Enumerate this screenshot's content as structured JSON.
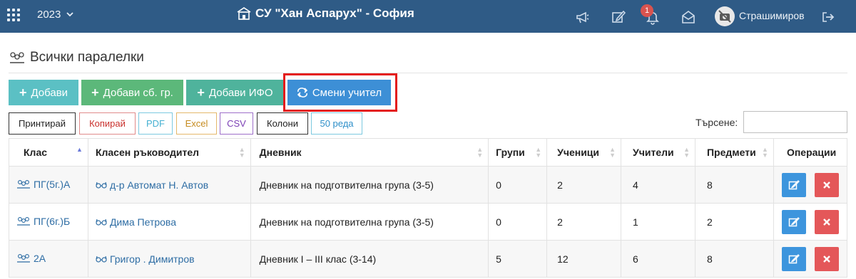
{
  "topbar": {
    "year": "2023",
    "school_name": "СУ \"Хан Аспарух\" - София",
    "notifications_count": "1",
    "username": "Страшимиров"
  },
  "page": {
    "title": "Всички паралелки"
  },
  "actions": {
    "add": "Добави",
    "add_group": "Добави сб. гр.",
    "add_ifo": "Добави ИФО",
    "change_teacher": "Смени учител"
  },
  "export": {
    "print": "Принтирай",
    "copy": "Копирай",
    "pdf": "PDF",
    "excel": "Excel",
    "csv": "CSV",
    "columns": "Колони",
    "page_size": "50 реда"
  },
  "search": {
    "label": "Търсене:",
    "value": ""
  },
  "table": {
    "headers": [
      "Клас",
      "Класен ръководител",
      "Дневник",
      "Групи",
      "Ученици",
      "Учители",
      "Предмети",
      "Операции"
    ],
    "rows": [
      {
        "klas": "ПГ(5г.)А",
        "teacher": "д-р Автомат Н. Автов",
        "diary": "Дневник на подготвителна група (3-5)",
        "groups": "0",
        "students": "2",
        "teachers": "4",
        "subjects": "8"
      },
      {
        "klas": "ПГ(6г.)Б",
        "teacher": "Дима Петрова",
        "diary": "Дневник на подготвителна група (3-5)",
        "groups": "0",
        "students": "2",
        "teachers": "1",
        "subjects": "2"
      },
      {
        "klas": "2А",
        "teacher": "Григор . Димитров",
        "diary": "Дневник I – III клас (3-14)",
        "groups": "5",
        "students": "12",
        "teachers": "6",
        "subjects": "8"
      }
    ]
  },
  "colors": {
    "header_bg": "#2f5b86",
    "link": "#2e6da4",
    "highlight": "#e41b1b"
  }
}
